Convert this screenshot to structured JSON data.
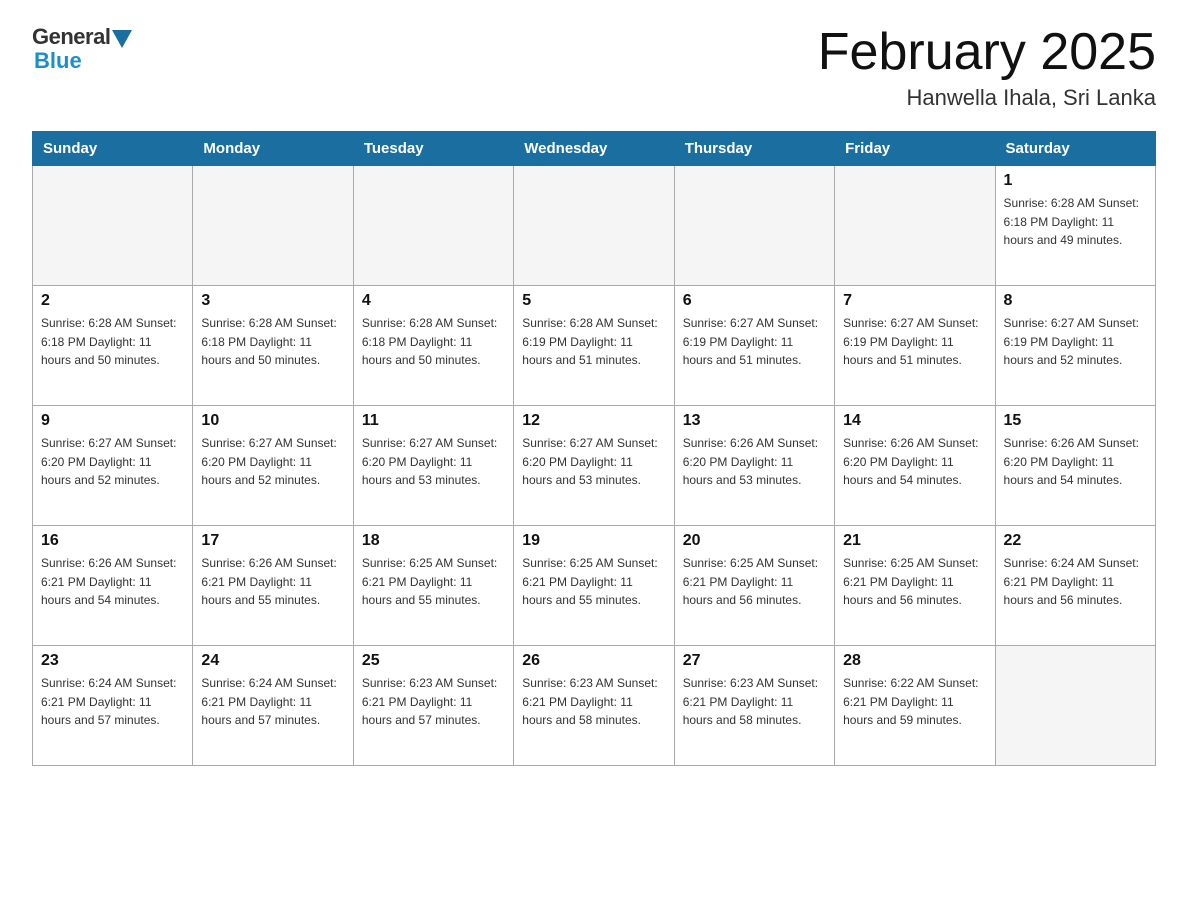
{
  "header": {
    "logo_general": "General",
    "logo_blue": "Blue",
    "month_title": "February 2025",
    "location": "Hanwella Ihala, Sri Lanka"
  },
  "weekdays": [
    "Sunday",
    "Monday",
    "Tuesday",
    "Wednesday",
    "Thursday",
    "Friday",
    "Saturday"
  ],
  "weeks": [
    [
      {
        "day": "",
        "info": ""
      },
      {
        "day": "",
        "info": ""
      },
      {
        "day": "",
        "info": ""
      },
      {
        "day": "",
        "info": ""
      },
      {
        "day": "",
        "info": ""
      },
      {
        "day": "",
        "info": ""
      },
      {
        "day": "1",
        "info": "Sunrise: 6:28 AM\nSunset: 6:18 PM\nDaylight: 11 hours\nand 49 minutes."
      }
    ],
    [
      {
        "day": "2",
        "info": "Sunrise: 6:28 AM\nSunset: 6:18 PM\nDaylight: 11 hours\nand 50 minutes."
      },
      {
        "day": "3",
        "info": "Sunrise: 6:28 AM\nSunset: 6:18 PM\nDaylight: 11 hours\nand 50 minutes."
      },
      {
        "day": "4",
        "info": "Sunrise: 6:28 AM\nSunset: 6:18 PM\nDaylight: 11 hours\nand 50 minutes."
      },
      {
        "day": "5",
        "info": "Sunrise: 6:28 AM\nSunset: 6:19 PM\nDaylight: 11 hours\nand 51 minutes."
      },
      {
        "day": "6",
        "info": "Sunrise: 6:27 AM\nSunset: 6:19 PM\nDaylight: 11 hours\nand 51 minutes."
      },
      {
        "day": "7",
        "info": "Sunrise: 6:27 AM\nSunset: 6:19 PM\nDaylight: 11 hours\nand 51 minutes."
      },
      {
        "day": "8",
        "info": "Sunrise: 6:27 AM\nSunset: 6:19 PM\nDaylight: 11 hours\nand 52 minutes."
      }
    ],
    [
      {
        "day": "9",
        "info": "Sunrise: 6:27 AM\nSunset: 6:20 PM\nDaylight: 11 hours\nand 52 minutes."
      },
      {
        "day": "10",
        "info": "Sunrise: 6:27 AM\nSunset: 6:20 PM\nDaylight: 11 hours\nand 52 minutes."
      },
      {
        "day": "11",
        "info": "Sunrise: 6:27 AM\nSunset: 6:20 PM\nDaylight: 11 hours\nand 53 minutes."
      },
      {
        "day": "12",
        "info": "Sunrise: 6:27 AM\nSunset: 6:20 PM\nDaylight: 11 hours\nand 53 minutes."
      },
      {
        "day": "13",
        "info": "Sunrise: 6:26 AM\nSunset: 6:20 PM\nDaylight: 11 hours\nand 53 minutes."
      },
      {
        "day": "14",
        "info": "Sunrise: 6:26 AM\nSunset: 6:20 PM\nDaylight: 11 hours\nand 54 minutes."
      },
      {
        "day": "15",
        "info": "Sunrise: 6:26 AM\nSunset: 6:20 PM\nDaylight: 11 hours\nand 54 minutes."
      }
    ],
    [
      {
        "day": "16",
        "info": "Sunrise: 6:26 AM\nSunset: 6:21 PM\nDaylight: 11 hours\nand 54 minutes."
      },
      {
        "day": "17",
        "info": "Sunrise: 6:26 AM\nSunset: 6:21 PM\nDaylight: 11 hours\nand 55 minutes."
      },
      {
        "day": "18",
        "info": "Sunrise: 6:25 AM\nSunset: 6:21 PM\nDaylight: 11 hours\nand 55 minutes."
      },
      {
        "day": "19",
        "info": "Sunrise: 6:25 AM\nSunset: 6:21 PM\nDaylight: 11 hours\nand 55 minutes."
      },
      {
        "day": "20",
        "info": "Sunrise: 6:25 AM\nSunset: 6:21 PM\nDaylight: 11 hours\nand 56 minutes."
      },
      {
        "day": "21",
        "info": "Sunrise: 6:25 AM\nSunset: 6:21 PM\nDaylight: 11 hours\nand 56 minutes."
      },
      {
        "day": "22",
        "info": "Sunrise: 6:24 AM\nSunset: 6:21 PM\nDaylight: 11 hours\nand 56 minutes."
      }
    ],
    [
      {
        "day": "23",
        "info": "Sunrise: 6:24 AM\nSunset: 6:21 PM\nDaylight: 11 hours\nand 57 minutes."
      },
      {
        "day": "24",
        "info": "Sunrise: 6:24 AM\nSunset: 6:21 PM\nDaylight: 11 hours\nand 57 minutes."
      },
      {
        "day": "25",
        "info": "Sunrise: 6:23 AM\nSunset: 6:21 PM\nDaylight: 11 hours\nand 57 minutes."
      },
      {
        "day": "26",
        "info": "Sunrise: 6:23 AM\nSunset: 6:21 PM\nDaylight: 11 hours\nand 58 minutes."
      },
      {
        "day": "27",
        "info": "Sunrise: 6:23 AM\nSunset: 6:21 PM\nDaylight: 11 hours\nand 58 minutes."
      },
      {
        "day": "28",
        "info": "Sunrise: 6:22 AM\nSunset: 6:21 PM\nDaylight: 11 hours\nand 59 minutes."
      },
      {
        "day": "",
        "info": ""
      }
    ]
  ]
}
